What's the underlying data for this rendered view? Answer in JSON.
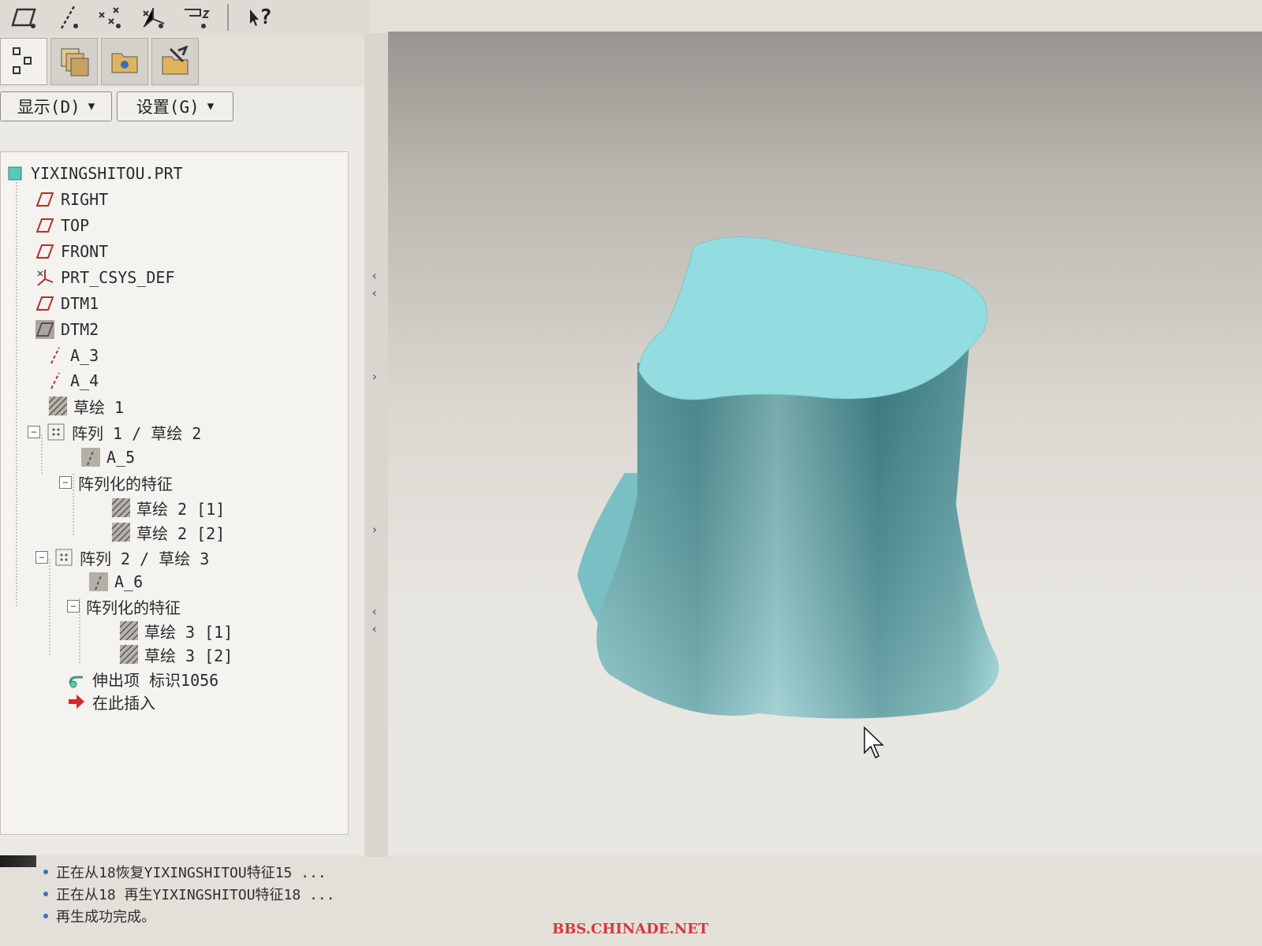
{
  "toolbar": {
    "icons": [
      "datum-plane-icon",
      "datum-axis-icon",
      "datum-point-icon",
      "datum-csys-icon",
      "datum-curve-icon"
    ],
    "help_glyph": "?"
  },
  "nav_tabs": [
    "model-tree-tab",
    "layer-tree-tab",
    "folder-browser-tab",
    "favorites-tab"
  ],
  "panel": {
    "display_label": "显示(D)",
    "settings_label": "设置(G)"
  },
  "tree": {
    "root": "YIXINGSHITOU.PRT",
    "right": "RIGHT",
    "top": "TOP",
    "front": "FRONT",
    "csys": "PRT_CSYS_DEF",
    "dtm1": "DTM1",
    "dtm2": "DTM2",
    "a3": "A_3",
    "a4": "A_4",
    "sketch1": "草绘 1",
    "pattern1": "阵列 1 / 草绘 2",
    "a5": "A_5",
    "pattern1_features": "阵列化的特征",
    "sketch2_1": "草绘 2 [1]",
    "sketch2_2": "草绘 2 [2]",
    "pattern2": "阵列 2 / 草绘 3",
    "a6": "A_6",
    "pattern2_features": "阵列化的特征",
    "sketch3_1": "草绘 3 [1]",
    "sketch3_2": "草绘 3 [2]",
    "extrude": "伸出项 标识1056",
    "insert_here": "在此插入",
    "expand_glyph": "−"
  },
  "messages": [
    "正在从18恢复YIXINGSHITOU特征15 ...",
    "正在从18 再生YIXINGSHITOU特征18 ...",
    "再生成功完成。"
  ],
  "watermark": "BBS.CHINADE.NET",
  "colors": {
    "model_top": "#8fdbe0",
    "model_side": "#5aa0a5",
    "plane_red": "#b3302a"
  }
}
